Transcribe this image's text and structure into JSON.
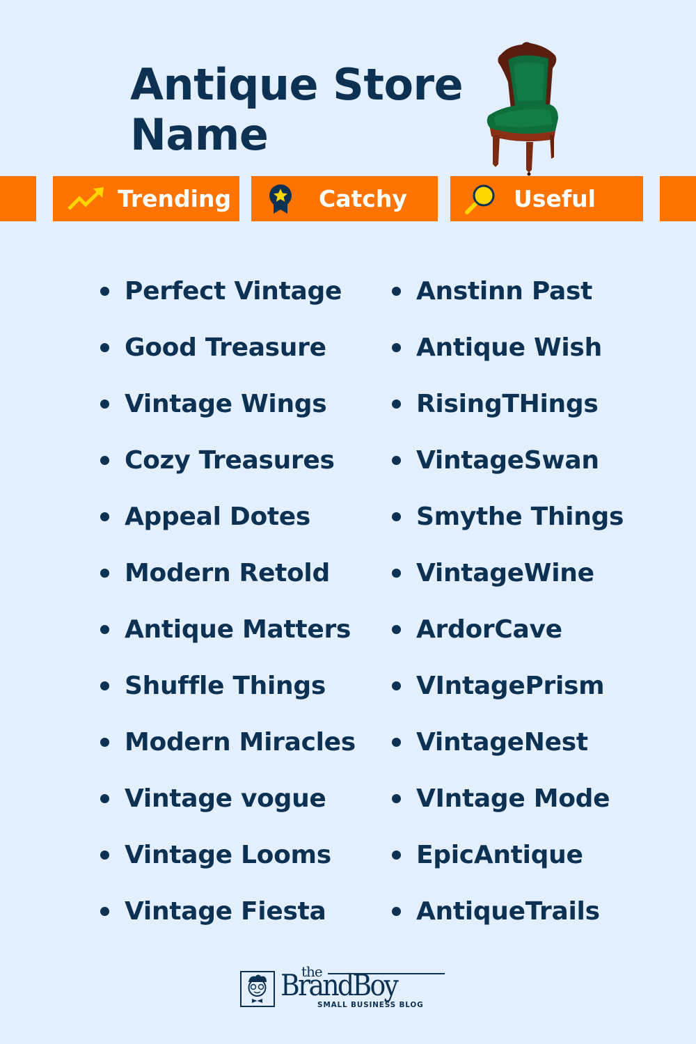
{
  "header": {
    "title_line1": "Antique Store",
    "title_line2": "Name",
    "image": "antique-green-chair"
  },
  "tags": [
    {
      "label": "Trending",
      "icon": "trending-up-arrow-icon"
    },
    {
      "label": "Catchy",
      "icon": "award-ribbon-star-icon"
    },
    {
      "label": "Useful",
      "icon": "magnifying-glass-icon"
    }
  ],
  "colors": {
    "background": "#e3effd",
    "accent": "#ff7300",
    "text": "#0c3152",
    "icon_yellow": "#ffd600"
  },
  "names": {
    "left": [
      "Perfect Vintage",
      "Good Treasure",
      "Vintage Wings",
      "Cozy Treasures",
      "Appeal Dotes",
      "Modern Retold",
      "Antique Matters",
      "Shuffle Things",
      "Modern Miracles",
      "Vintage vogue",
      "Vintage Looms",
      "Vintage Fiesta"
    ],
    "right": [
      "Anstinn Past",
      "Antique Wish",
      "RisingTHings",
      "VintageSwan",
      "Smythe Things",
      "VintageWine",
      "ArdorCave",
      "VIntagePrism",
      "VintageNest",
      "VIntage Mode",
      "EpicAntique",
      "AntiqueTrails"
    ]
  },
  "footer": {
    "logo_the": "the",
    "logo_brand": "BrandBoy",
    "logo_tagline": "SMALL BUSINESS BLOG"
  }
}
